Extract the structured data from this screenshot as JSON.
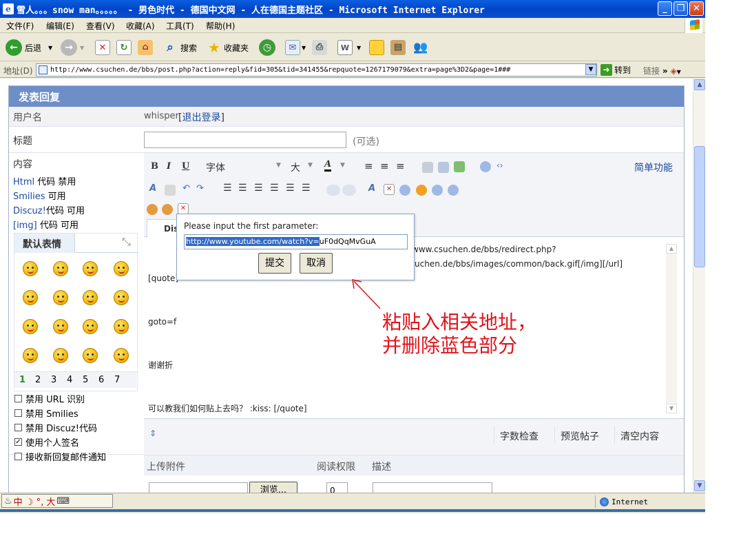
{
  "window": {
    "title": "雪人。。。snow man。。。。。 - 男色时代 - 德国中文网 - 人在德国主题社区 - Microsoft Internet Explorer",
    "app_icon": "e",
    "buttons": {
      "minimize": "_",
      "maximize": "❐",
      "close": "✕"
    }
  },
  "menu": [
    "文件(F)",
    "编辑(E)",
    "查看(V)",
    "收藏(A)",
    "工具(T)",
    "帮助(H)"
  ],
  "toolbar": {
    "back": "后退",
    "search": "搜索",
    "favorites": "收藏夹"
  },
  "address": {
    "label": "地址(D)",
    "url": "http://www.csuchen.de/bbs/post.php?action=reply&fid=305&tid=341455&repquote=1267179079&extra=page%3D2&page=1###",
    "go": "转到",
    "links": "链接"
  },
  "form": {
    "heading": "发表回复",
    "username_label": "用户名",
    "username_value": "whisper",
    "logout_link": "退出登录",
    "subject_label": "标题",
    "subject_value": "",
    "optional_hint": "(可选)",
    "content_label": "内容",
    "status": [
      {
        "name": "Html",
        "rest": "代码 禁用"
      },
      {
        "name": "Smilies",
        "rest": "可用"
      },
      {
        "name": "Discuz!",
        "rest": "代码 可用"
      },
      {
        "name": "[img]",
        "rest": "代码 可用"
      }
    ],
    "smilies_tab": "默认表情",
    "smilies_pages": [
      "1",
      "2",
      "3",
      "4",
      "5",
      "6",
      "7"
    ],
    "options": [
      {
        "text": "禁用 URL 识别",
        "checked": false
      },
      {
        "text": "禁用 Smilies",
        "checked": false
      },
      {
        "text": "禁用 Discuz!代码",
        "checked": false
      },
      {
        "text": "使用个人签名",
        "checked": true
      },
      {
        "text": "接收新回复邮件通知",
        "checked": false
      }
    ]
  },
  "editor": {
    "font_label": "字体",
    "size_label": "大",
    "simple_mode": "简单功能",
    "tab": "Dis",
    "text_lines": [
      "[quote]",
      "goto=f",
      "谢谢折",
      "可以教我们如何贴上去吗？ :kiss: [/quote]"
    ],
    "text_right_lines": [
      "www.csuchen.de/bbs/redirect.php?",
      "uchen.de/bbs/images/common/back.gif[/img][/url]"
    ],
    "bottom_buttons": [
      "字数检查",
      "预览帖子",
      "清空内容"
    ]
  },
  "upload": {
    "col1": "上传附件",
    "col2": "阅读权限",
    "col3": "描述",
    "browse": "浏览...",
    "permission_value": "0"
  },
  "popup": {
    "prompt": "Please input the first parameter:",
    "value_selected": "http://www.youtube.com/watch?v=",
    "value_rest": "uF0dQqMvGuA",
    "submit": "提交",
    "cancel": "取消"
  },
  "annotation": {
    "line1": "粘贴入相关地址，",
    "line2": "并删除蓝色部分"
  },
  "status_bar": {
    "ime": "中 ☽ °, 大",
    "zone": "Internet"
  }
}
